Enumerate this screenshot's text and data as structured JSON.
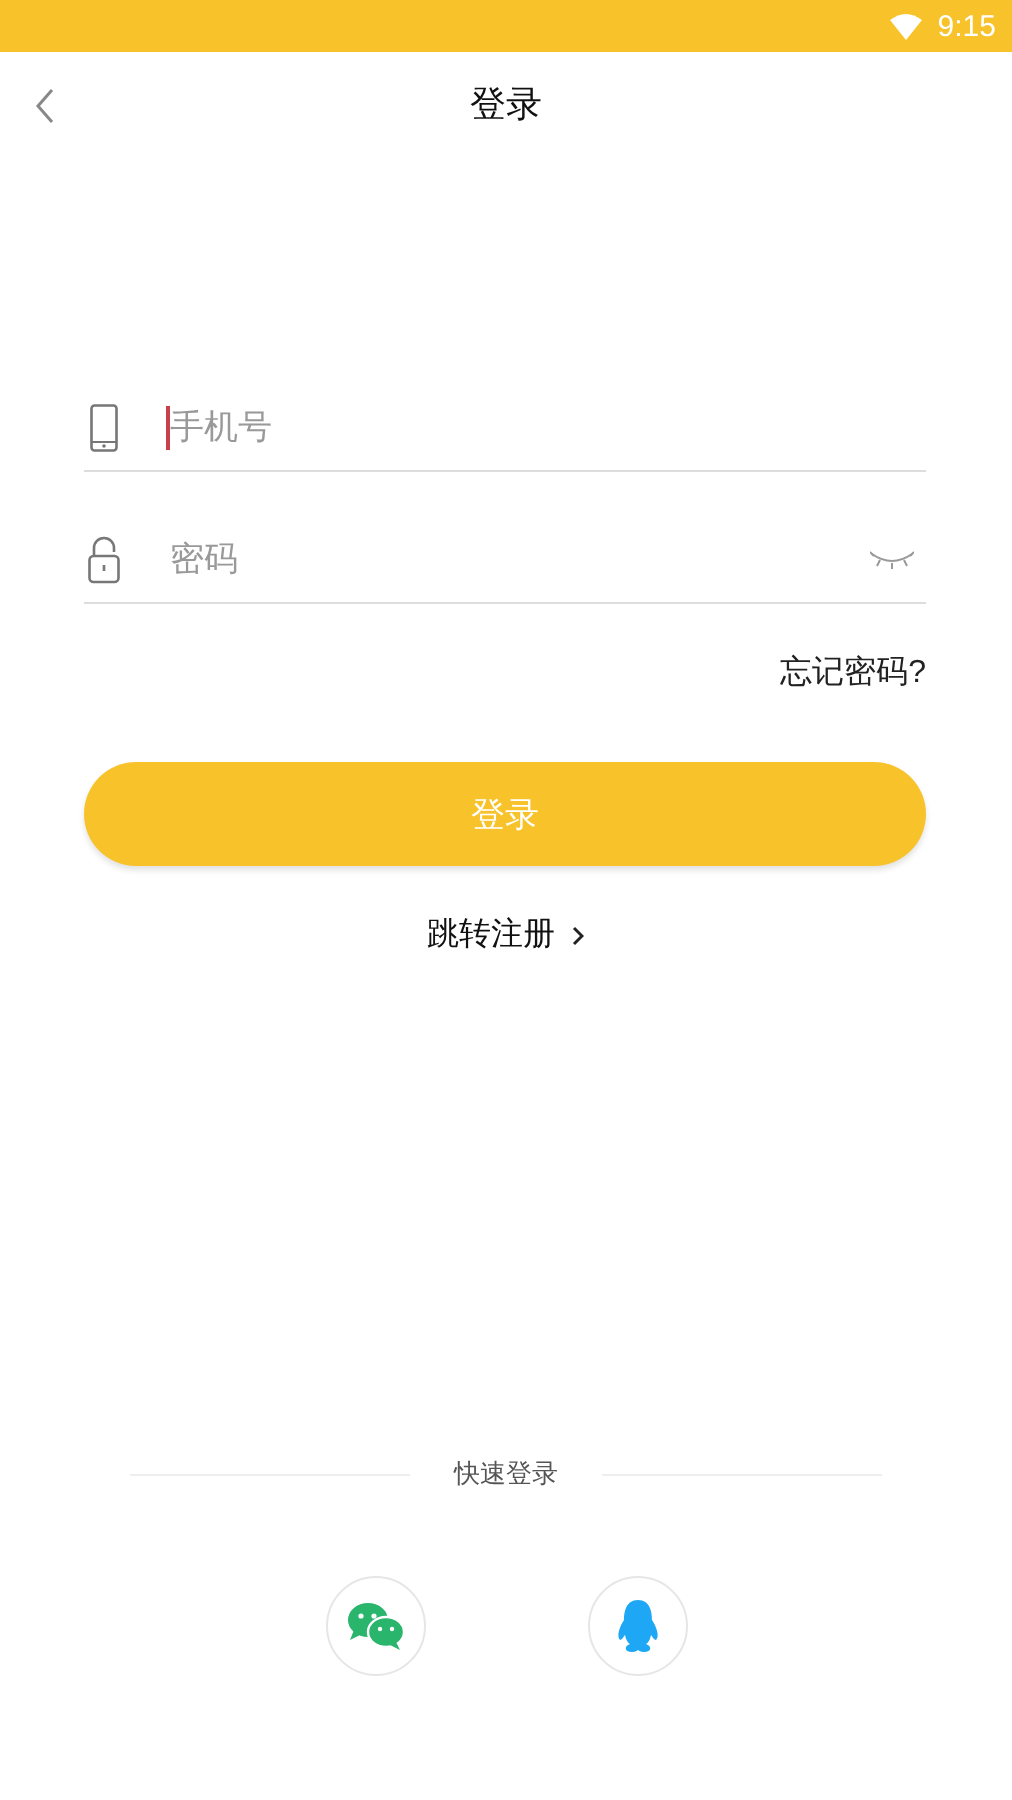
{
  "status_bar": {
    "time": "9:15"
  },
  "header": {
    "title": "登录"
  },
  "fields": [
    {
      "kind": "phone",
      "placeholder": "手机号",
      "focused": true
    },
    {
      "kind": "password",
      "placeholder": "密码",
      "focused": false
    }
  ],
  "forgot_link": "忘记密码?",
  "login_button": "登录",
  "register_link": "跳转注册",
  "quick_login": {
    "label": "快速登录",
    "providers": [
      {
        "kind": "wechat"
      },
      {
        "kind": "qq"
      }
    ]
  }
}
